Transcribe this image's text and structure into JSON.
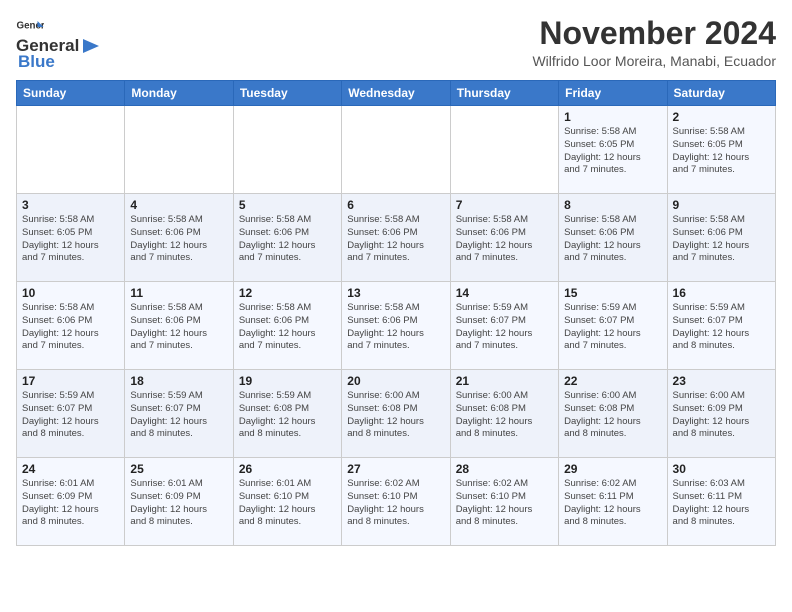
{
  "logo": {
    "line1": "General",
    "line2": "Blue"
  },
  "header": {
    "month": "November 2024",
    "location": "Wilfrido Loor Moreira, Manabi, Ecuador"
  },
  "days_of_week": [
    "Sunday",
    "Monday",
    "Tuesday",
    "Wednesday",
    "Thursday",
    "Friday",
    "Saturday"
  ],
  "weeks": [
    [
      {
        "day": "",
        "info": ""
      },
      {
        "day": "",
        "info": ""
      },
      {
        "day": "",
        "info": ""
      },
      {
        "day": "",
        "info": ""
      },
      {
        "day": "",
        "info": ""
      },
      {
        "day": "1",
        "info": "Sunrise: 5:58 AM\nSunset: 6:05 PM\nDaylight: 12 hours\nand 7 minutes."
      },
      {
        "day": "2",
        "info": "Sunrise: 5:58 AM\nSunset: 6:05 PM\nDaylight: 12 hours\nand 7 minutes."
      }
    ],
    [
      {
        "day": "3",
        "info": "Sunrise: 5:58 AM\nSunset: 6:05 PM\nDaylight: 12 hours\nand 7 minutes."
      },
      {
        "day": "4",
        "info": "Sunrise: 5:58 AM\nSunset: 6:06 PM\nDaylight: 12 hours\nand 7 minutes."
      },
      {
        "day": "5",
        "info": "Sunrise: 5:58 AM\nSunset: 6:06 PM\nDaylight: 12 hours\nand 7 minutes."
      },
      {
        "day": "6",
        "info": "Sunrise: 5:58 AM\nSunset: 6:06 PM\nDaylight: 12 hours\nand 7 minutes."
      },
      {
        "day": "7",
        "info": "Sunrise: 5:58 AM\nSunset: 6:06 PM\nDaylight: 12 hours\nand 7 minutes."
      },
      {
        "day": "8",
        "info": "Sunrise: 5:58 AM\nSunset: 6:06 PM\nDaylight: 12 hours\nand 7 minutes."
      },
      {
        "day": "9",
        "info": "Sunrise: 5:58 AM\nSunset: 6:06 PM\nDaylight: 12 hours\nand 7 minutes."
      }
    ],
    [
      {
        "day": "10",
        "info": "Sunrise: 5:58 AM\nSunset: 6:06 PM\nDaylight: 12 hours\nand 7 minutes."
      },
      {
        "day": "11",
        "info": "Sunrise: 5:58 AM\nSunset: 6:06 PM\nDaylight: 12 hours\nand 7 minutes."
      },
      {
        "day": "12",
        "info": "Sunrise: 5:58 AM\nSunset: 6:06 PM\nDaylight: 12 hours\nand 7 minutes."
      },
      {
        "day": "13",
        "info": "Sunrise: 5:58 AM\nSunset: 6:06 PM\nDaylight: 12 hours\nand 7 minutes."
      },
      {
        "day": "14",
        "info": "Sunrise: 5:59 AM\nSunset: 6:07 PM\nDaylight: 12 hours\nand 7 minutes."
      },
      {
        "day": "15",
        "info": "Sunrise: 5:59 AM\nSunset: 6:07 PM\nDaylight: 12 hours\nand 7 minutes."
      },
      {
        "day": "16",
        "info": "Sunrise: 5:59 AM\nSunset: 6:07 PM\nDaylight: 12 hours\nand 8 minutes."
      }
    ],
    [
      {
        "day": "17",
        "info": "Sunrise: 5:59 AM\nSunset: 6:07 PM\nDaylight: 12 hours\nand 8 minutes."
      },
      {
        "day": "18",
        "info": "Sunrise: 5:59 AM\nSunset: 6:07 PM\nDaylight: 12 hours\nand 8 minutes."
      },
      {
        "day": "19",
        "info": "Sunrise: 5:59 AM\nSunset: 6:08 PM\nDaylight: 12 hours\nand 8 minutes."
      },
      {
        "day": "20",
        "info": "Sunrise: 6:00 AM\nSunset: 6:08 PM\nDaylight: 12 hours\nand 8 minutes."
      },
      {
        "day": "21",
        "info": "Sunrise: 6:00 AM\nSunset: 6:08 PM\nDaylight: 12 hours\nand 8 minutes."
      },
      {
        "day": "22",
        "info": "Sunrise: 6:00 AM\nSunset: 6:08 PM\nDaylight: 12 hours\nand 8 minutes."
      },
      {
        "day": "23",
        "info": "Sunrise: 6:00 AM\nSunset: 6:09 PM\nDaylight: 12 hours\nand 8 minutes."
      }
    ],
    [
      {
        "day": "24",
        "info": "Sunrise: 6:01 AM\nSunset: 6:09 PM\nDaylight: 12 hours\nand 8 minutes."
      },
      {
        "day": "25",
        "info": "Sunrise: 6:01 AM\nSunset: 6:09 PM\nDaylight: 12 hours\nand 8 minutes."
      },
      {
        "day": "26",
        "info": "Sunrise: 6:01 AM\nSunset: 6:10 PM\nDaylight: 12 hours\nand 8 minutes."
      },
      {
        "day": "27",
        "info": "Sunrise: 6:02 AM\nSunset: 6:10 PM\nDaylight: 12 hours\nand 8 minutes."
      },
      {
        "day": "28",
        "info": "Sunrise: 6:02 AM\nSunset: 6:10 PM\nDaylight: 12 hours\nand 8 minutes."
      },
      {
        "day": "29",
        "info": "Sunrise: 6:02 AM\nSunset: 6:11 PM\nDaylight: 12 hours\nand 8 minutes."
      },
      {
        "day": "30",
        "info": "Sunrise: 6:03 AM\nSunset: 6:11 PM\nDaylight: 12 hours\nand 8 minutes."
      }
    ]
  ]
}
